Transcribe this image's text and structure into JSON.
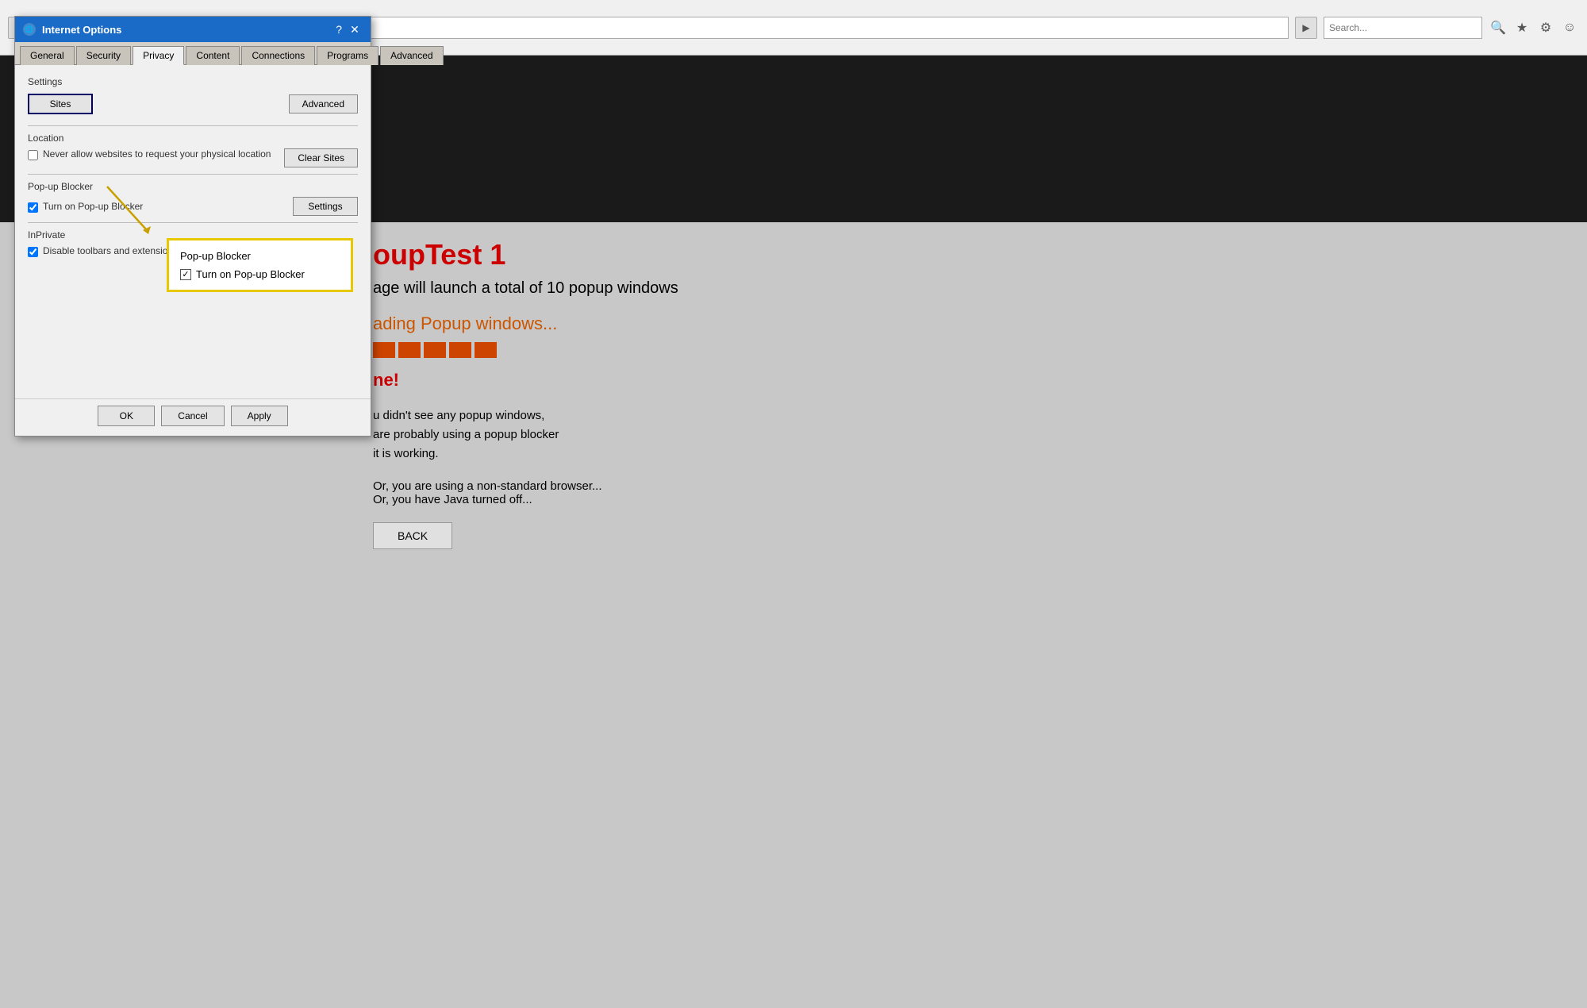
{
  "browser": {
    "search_placeholder": "Search...",
    "toolbar": {
      "nav_back": "◀",
      "nav_forward": "▶",
      "refresh": "↻",
      "home": "⌂",
      "favorites": "★",
      "tools": "⚙",
      "face": "☺"
    }
  },
  "dialog": {
    "title": "Internet Options",
    "help_label": "?",
    "tabs": [
      {
        "label": "General",
        "active": false
      },
      {
        "label": "Security",
        "active": false
      },
      {
        "label": "Privacy",
        "active": true
      },
      {
        "label": "Content",
        "active": false
      },
      {
        "label": "Connections",
        "active": false
      },
      {
        "label": "Programs",
        "active": false
      },
      {
        "label": "Advanced",
        "active": false
      }
    ],
    "settings_label": "Settings",
    "sites_btn": "Sites",
    "advanced_btn": "Advanced",
    "location_section": "Location",
    "never_allow_label": "Never allow websites to request your physical location",
    "clear_sites_btn": "Clear Sites",
    "popup_blocker_section": "Pop-up Blocker",
    "turn_on_popup_label": "Turn on Pop-up Blocker",
    "popup_settings_btn": "Settings",
    "inprivate_section": "InPrivate",
    "disable_toolbars_label": "Disable toolbars and extensions when InPrivate Browsing starts",
    "footer": {
      "ok_btn": "OK",
      "cancel_btn": "Cancel",
      "apply_btn": "Apply"
    }
  },
  "highlight_box": {
    "title": "Pop-up Blocker",
    "checkbox_label": "Turn on Pop-up Blocker",
    "checked": true
  },
  "webpage": {
    "title": "oupTest 1",
    "subtitle": "age will launch a total of 10 popup windows",
    "loading_text": "ading Popup windows...",
    "done_text": "ne!",
    "success_line1": "u didn't see any popup windows,",
    "success_line2": "are probably using a popup blocker",
    "success_line3": "it is working.",
    "or_line1": "Or, you are using a non-standard browser...",
    "or_line2": "Or, you have Java turned off...",
    "back_btn": "BACK"
  },
  "titlebar_buttons": {
    "minimize": "—",
    "maximize": "□",
    "close": "✕"
  }
}
